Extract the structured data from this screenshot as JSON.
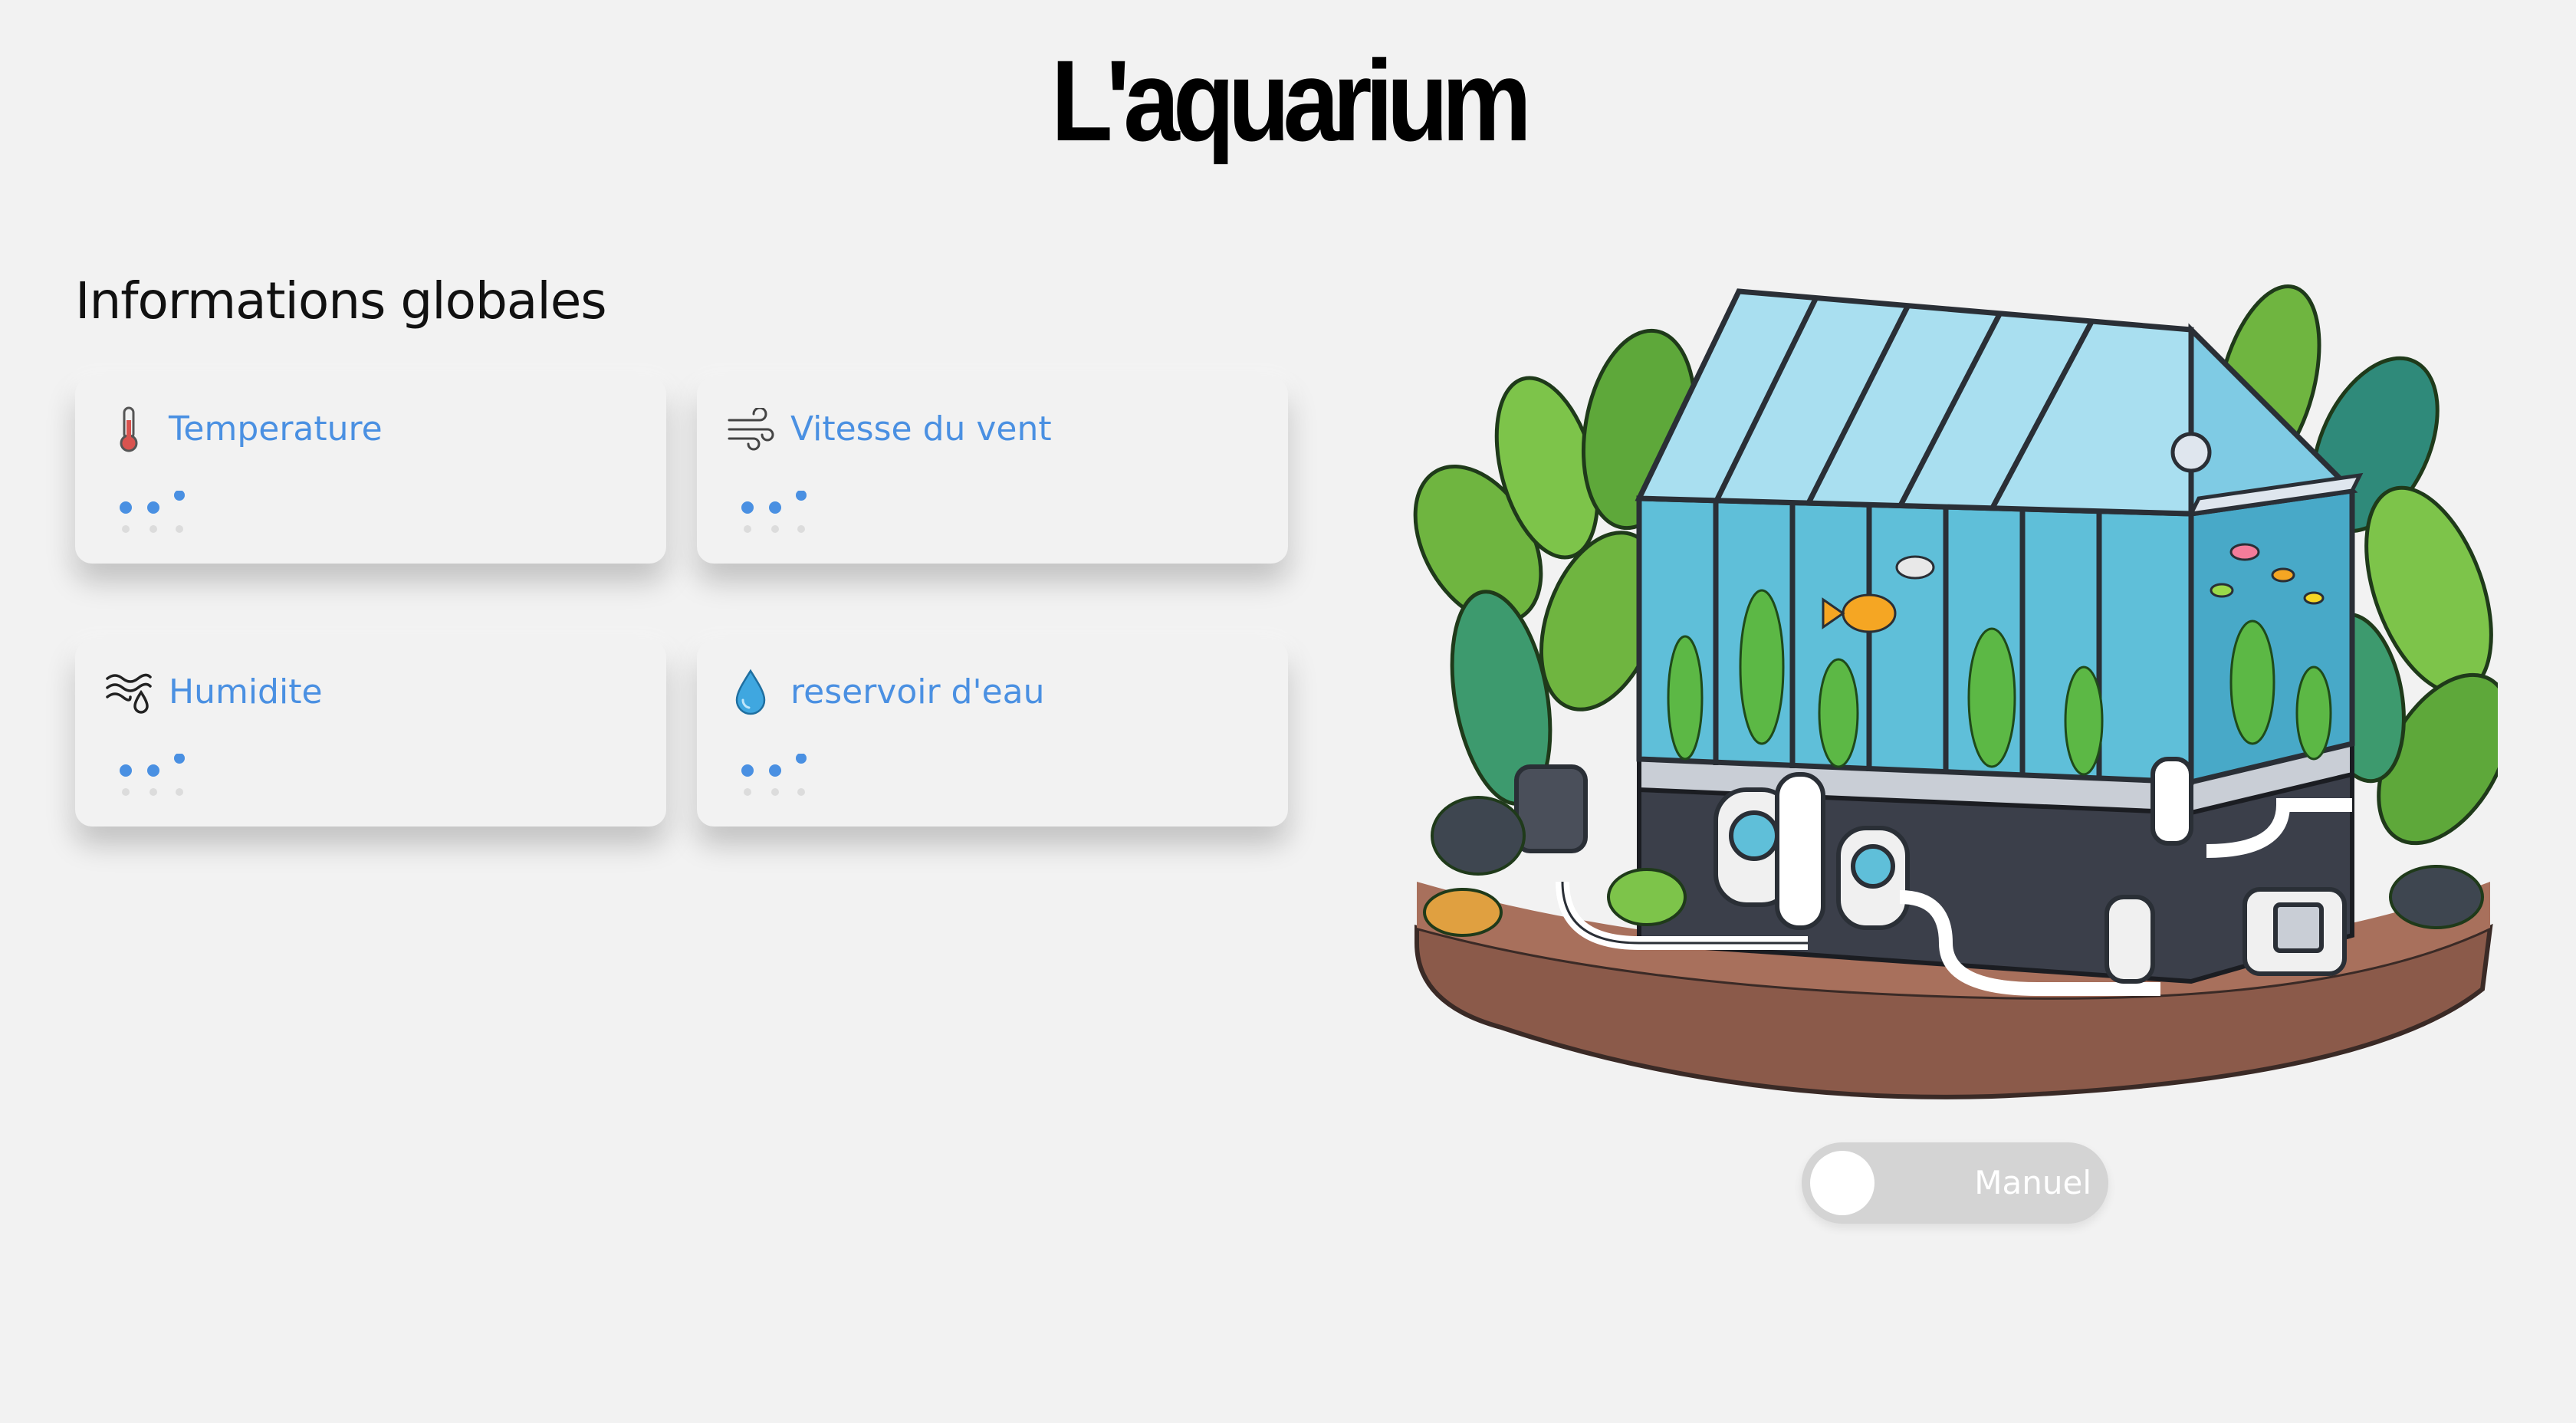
{
  "header": {
    "title": "L'aquarium"
  },
  "section": {
    "title": "Informations globales"
  },
  "cards": [
    {
      "label": "Temperature",
      "icon": "thermometer-icon"
    },
    {
      "label": "Vitesse du vent",
      "icon": "wind-icon"
    },
    {
      "label": "Humidite",
      "icon": "humidity-icon"
    },
    {
      "label": "reservoir d'eau",
      "icon": "water-drop-icon"
    }
  ],
  "illustration": {
    "subject": "aquarium-greenhouse-illustration"
  },
  "toggle": {
    "label": "Manuel",
    "state": "off"
  },
  "colors": {
    "background": "#f2f2f2",
    "accent": "#4a90e2",
    "toggle_track": "#d4d4d4",
    "toggle_knob": "#ffffff"
  }
}
